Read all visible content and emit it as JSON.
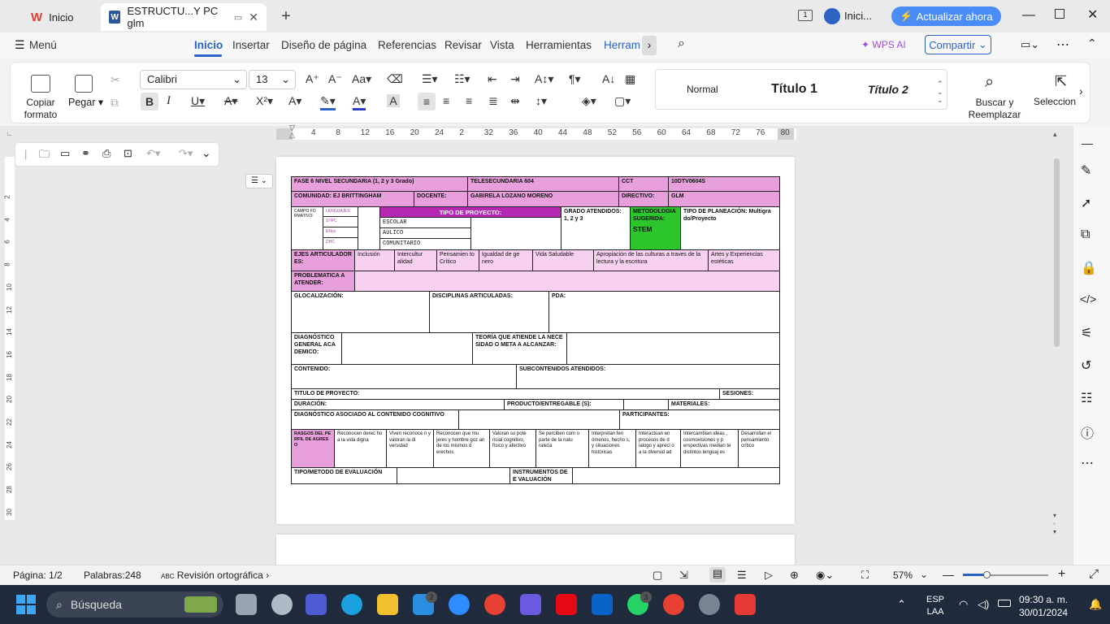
{
  "titlebar": {
    "home_tab": "Inicio",
    "doc_tab": "ESTRUCTU...Y PC glm",
    "account": "Inici...",
    "update_button": "Actualizar ahora"
  },
  "menubar": {
    "menu": "Menú",
    "items": [
      "Inicio",
      "Insertar",
      "Diseño de página",
      "Referencias",
      "Revisar",
      "Vista",
      "Herramientas",
      "Herram"
    ],
    "wps_ai": "WPS AI",
    "share": "Compartir"
  },
  "ribbon": {
    "copy_format": "Copiar formato",
    "paste": "Pegar",
    "font_name": "Calibri",
    "font_size": "13",
    "styles": [
      "Normal",
      "Título 1",
      "Título 2"
    ],
    "find_replace": "Buscar y Reemplazar",
    "select": "Seleccion"
  },
  "ruler": [
    "4",
    "8",
    "12",
    "16",
    "20",
    "24",
    "2",
    "32",
    "36",
    "40",
    "44",
    "48",
    "52",
    "56",
    "60",
    "64",
    "68",
    "72",
    "76",
    "80"
  ],
  "vruler": [
    "2",
    "4",
    "6",
    "8",
    "10",
    "12",
    "14",
    "16",
    "18",
    "20",
    "22",
    "24",
    "26",
    "28",
    "30"
  ],
  "doc": {
    "fase": "FASE 6 NIVEL SECUNDARIA (1, 2 y 3 Grado)",
    "telesec": "TELESECUNDARIA 604",
    "cct_label": "CCT",
    "cct": "10DTV0604S",
    "comunidad": "COMUNIDAD: EJ BRITTINGHAM",
    "docente_label": "DOCENTE:",
    "docente": "GABIRELA LOZANO MORENO",
    "director_label": "DIRECTIVO:",
    "director": "GLM",
    "campo": "CAMPO FO RMATIVO:",
    "campos": [
      "LENGUAJES",
      "SYPC",
      "ENys",
      "DHC"
    ],
    "tipo_proyecto": "TIPO DE PROYECTO:",
    "tipos": [
      "ESCOLAR",
      "AULICO",
      "COMUNITARIO"
    ],
    "grado": "GRADO ATENDIDOS: 1, 2 y 3",
    "metodologia": "METODOLOGIA SUGERIDA:",
    "stem": "STEM",
    "planeacion": "TIPO DE PLANEACIÓN: Multigra do/Proyecto",
    "ejes_label": "EJES ARTICULADOR ES:",
    "ejes": [
      "Inclusión",
      "Intercultur alidad",
      "Pensamien to Crítico",
      "Igualdad de ge nero",
      "Vida Saludable",
      "Apropiación de las culturas a traves de la lectura y la escritura",
      "Artes y Experiencias estéticas"
    ],
    "problematica": "PROBLEMATICA A ATENDER:",
    "glocal": "GLOCALIZACIÓN:",
    "disciplinas": "DISCIPLINAS ARTICULADAS:",
    "pda": "PDA:",
    "diagnostico": "DIAGNÓSTICO GENERAL ACA DEMICO:",
    "teoria": "TEORÍA QUE ATIENDE LA NECE SIDAD O META A ALCANZAR:",
    "contenido": "CONTENIDO:",
    "subcontenidos": "SUBCONTENIDOS ATENDIDOS:",
    "titulo": "TITULO DE PROYECTO:",
    "sesiones": "SESIONES:",
    "duracion": "DURACIÓN:",
    "producto": "PRODUCTO/ENTREGABLE (S):",
    "materiales": "MATERIALES:",
    "diag_asociado": "DIAGNÓSTICO ASOCIADO AL CONTENIDO COGNITIVO",
    "participantes": "PARTICIPANTES:",
    "rasgos": "RASGOS DEL PE RFIL DE AGRES O",
    "rasgos_items": [
      "Reconocen derec ho a la vida digna",
      "Viven reconoce n y valoran la di versidad",
      "Reconocen que mu jeres y hombre goz an de los mismos d erechos",
      "Valoran su pote ncial cognitivo, físico y afectivo",
      "Se perciben com o parte de la natu raleza",
      "Interpretan fen ómenos, hecho s, y situaciones históricas",
      "Interactúan en procesos de d ialogo y apreci o a la diversid ad",
      "Intercambian ideas , cosmovisiones y p erspectivas median te distintos lenguaj es",
      "Desarrollan el pensamiento crítico"
    ],
    "tipo_eval": "TIPO/METODO DE EVALUACIÓN",
    "instrumentos": "INSTRUMENTOS DE E VALUACIÓN"
  },
  "status": {
    "page": "Página: 1/2",
    "words": "Palabras:248",
    "spell": "Revisión ortográfica",
    "zoom": "57%"
  },
  "taskbar": {
    "search": "Búsqueda",
    "lang1": "ESP",
    "lang2": "LAA",
    "time": "09:30 a. m.",
    "date": "30/01/2024",
    "badge_mail": "2",
    "badge_whatsapp": "3"
  },
  "colors": {
    "accent": "#2b62c4",
    "pink": "#e8a0dc",
    "purple": "#b428b4",
    "green": "#2cc52c"
  }
}
